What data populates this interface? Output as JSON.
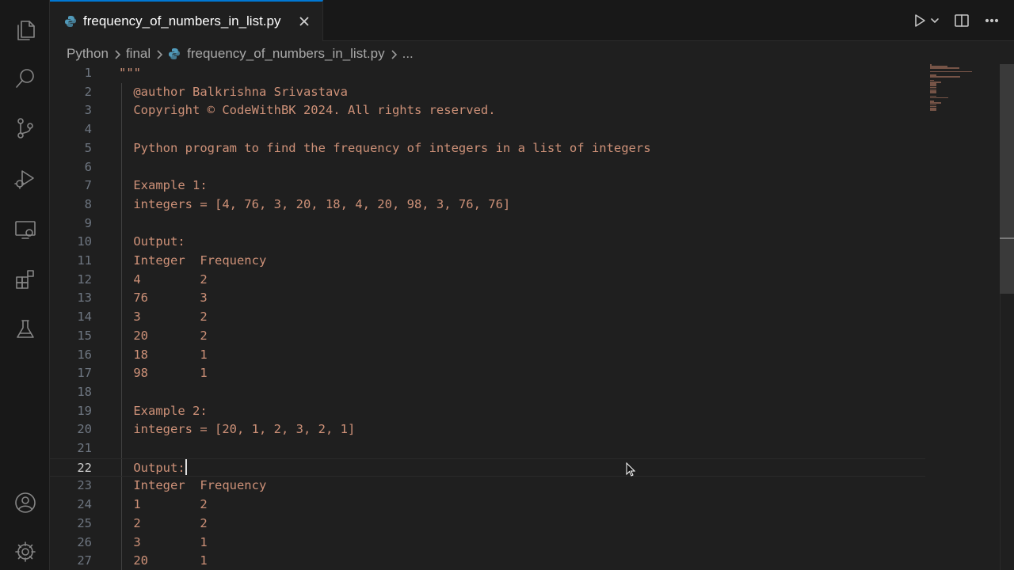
{
  "activity_bar": {
    "items": [
      {
        "name": "explorer-icon"
      },
      {
        "name": "search-icon"
      },
      {
        "name": "source-control-icon"
      },
      {
        "name": "run-debug-icon"
      },
      {
        "name": "remote-explorer-icon"
      },
      {
        "name": "extensions-icon"
      },
      {
        "name": "testing-icon"
      }
    ],
    "bottom": [
      {
        "name": "account-icon"
      },
      {
        "name": "settings-gear-icon"
      }
    ]
  },
  "tab": {
    "label": "frequency_of_numbers_in_list.py"
  },
  "breadcrumb": {
    "items": [
      "Python",
      "final",
      "frequency_of_numbers_in_list.py",
      "..."
    ]
  },
  "editor": {
    "current_line": 22,
    "lines": [
      {
        "n": "1",
        "text": "\"\"\""
      },
      {
        "n": "2",
        "text": " @author Balkrishna Srivastava"
      },
      {
        "n": "3",
        "text": " Copyright © CodeWithBK 2024. All rights reserved."
      },
      {
        "n": "4",
        "text": ""
      },
      {
        "n": "5",
        "text": " Python program to find the frequency of integers in a list of integers"
      },
      {
        "n": "6",
        "text": ""
      },
      {
        "n": "7",
        "text": " Example 1:"
      },
      {
        "n": "8",
        "text": " integers = [4, 76, 3, 20, 18, 4, 20, 98, 3, 76, 76]"
      },
      {
        "n": "9",
        "text": ""
      },
      {
        "n": "10",
        "text": " Output:"
      },
      {
        "n": "11",
        "text": " Integer  Frequency"
      },
      {
        "n": "12",
        "text": " 4        2"
      },
      {
        "n": "13",
        "text": " 76       3"
      },
      {
        "n": "14",
        "text": " 3        2"
      },
      {
        "n": "15",
        "text": " 20       2"
      },
      {
        "n": "16",
        "text": " 18       1"
      },
      {
        "n": "17",
        "text": " 98       1"
      },
      {
        "n": "18",
        "text": ""
      },
      {
        "n": "19",
        "text": " Example 2:"
      },
      {
        "n": "20",
        "text": " integers = [20, 1, 2, 3, 2, 1]"
      },
      {
        "n": "21",
        "text": ""
      },
      {
        "n": "22",
        "text": " Output:"
      },
      {
        "n": "23",
        "text": " Integer  Frequency"
      },
      {
        "n": "24",
        "text": " 1        2"
      },
      {
        "n": "25",
        "text": " 2        2"
      },
      {
        "n": "26",
        "text": " 3        1"
      },
      {
        "n": "27",
        "text": " 20       1"
      }
    ]
  },
  "colors": {
    "string": "#ce9178",
    "line_number": "#6e7681",
    "accent": "#0078d4",
    "python_icon": "#519aba"
  }
}
